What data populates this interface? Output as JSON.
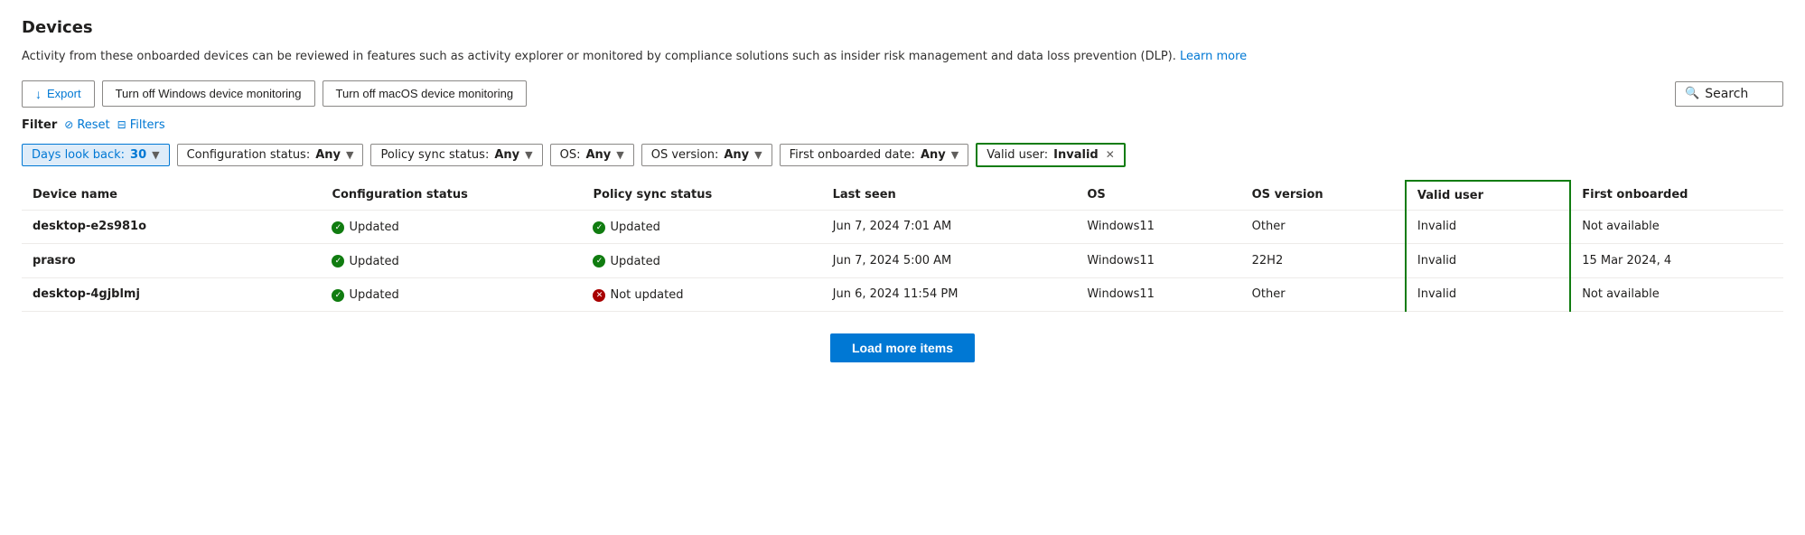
{
  "page": {
    "title": "Devices",
    "description": "Activity from these onboarded devices can be reviewed in features such as activity explorer or monitored by compliance solutions such as insider risk management and data loss prevention (DLP).",
    "learn_more": "Learn more"
  },
  "toolbar": {
    "export_label": "Export",
    "btn_windows": "Turn off Windows device monitoring",
    "btn_macos": "Turn off macOS device monitoring",
    "search_placeholder": "Search",
    "search_label": "Search"
  },
  "filter_bar": {
    "filter_label": "Filter",
    "reset_label": "Reset",
    "filters_label": "Filters"
  },
  "chips": [
    {
      "id": "days",
      "label": "Days look back:",
      "value": "30",
      "type": "days"
    },
    {
      "id": "config",
      "label": "Configuration status:",
      "value": "Any",
      "type": "dropdown"
    },
    {
      "id": "policy",
      "label": "Policy sync status:",
      "value": "Any",
      "type": "dropdown"
    },
    {
      "id": "os",
      "label": "OS:",
      "value": "Any",
      "type": "dropdown"
    },
    {
      "id": "osver",
      "label": "OS version:",
      "value": "Any",
      "type": "dropdown"
    },
    {
      "id": "firstonboard",
      "label": "First onboarded date:",
      "value": "Any",
      "type": "dropdown"
    },
    {
      "id": "validuser",
      "label": "Valid user:",
      "value": "Invalid",
      "type": "removable",
      "highlighted": true
    }
  ],
  "table": {
    "columns": [
      {
        "id": "device_name",
        "label": "Device name"
      },
      {
        "id": "config_status",
        "label": "Configuration status"
      },
      {
        "id": "policy_sync",
        "label": "Policy sync status"
      },
      {
        "id": "last_seen",
        "label": "Last seen"
      },
      {
        "id": "os",
        "label": "OS"
      },
      {
        "id": "os_version",
        "label": "OS version"
      },
      {
        "id": "valid_user",
        "label": "Valid user",
        "highlighted": true
      },
      {
        "id": "first_onboarded",
        "label": "First onboarded"
      }
    ],
    "rows": [
      {
        "device_name": "desktop-e2s981o",
        "config_status": "Updated",
        "config_status_type": "green",
        "policy_sync": "Updated",
        "policy_sync_type": "green",
        "last_seen": "Jun 7, 2024 7:01 AM",
        "os": "Windows11",
        "os_version": "Other",
        "valid_user": "Invalid",
        "first_onboarded": "Not available"
      },
      {
        "device_name": "prasro",
        "config_status": "Updated",
        "config_status_type": "green",
        "policy_sync": "Updated",
        "policy_sync_type": "green",
        "last_seen": "Jun 7, 2024 5:00 AM",
        "os": "Windows11",
        "os_version": "22H2",
        "valid_user": "Invalid",
        "first_onboarded": "15 Mar 2024, 4"
      },
      {
        "device_name": "desktop-4gjblmj",
        "config_status": "Updated",
        "config_status_type": "green",
        "policy_sync": "Not updated",
        "policy_sync_type": "red",
        "last_seen": "Jun 6, 2024 11:54 PM",
        "os": "Windows11",
        "os_version": "Other",
        "valid_user": "Invalid",
        "first_onboarded": "Not available"
      }
    ]
  },
  "load_more": {
    "label": "Load more items"
  },
  "colors": {
    "green": "#107c10",
    "red": "#a80000",
    "blue": "#0078d4",
    "highlight_border": "#107c10"
  }
}
